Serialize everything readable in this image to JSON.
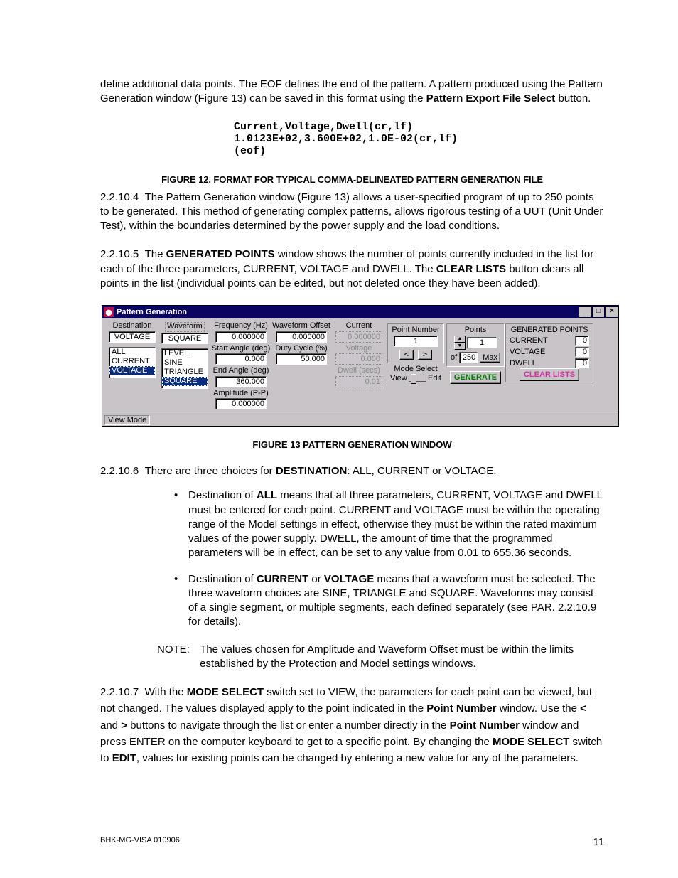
{
  "intro_para": "define additional data points. The EOF defines the end of the pattern. A pattern produced using the Pattern Generation window (Figure 13) can be saved in this format using the ",
  "intro_bold": "Pattern Export File Select",
  "intro_tail": " button.",
  "pre_line1": "Current,Voltage,Dwell(cr,lf)",
  "pre_line2": "1.0123E+02,3.600E+02,1.0E-02(cr,lf)",
  "pre_line3": "(eof)",
  "fig12": "FIGURE 12.    FORMAT FOR TYPICAL COMMA-DELINEATED PATTERN GENERATION FILE",
  "p_2_2_10_4_num": "2.2.10.4",
  "p_2_2_10_4": "The Pattern Generation window (Figure 13) allows a user-specified program of up to 250 points to be generated. This method of generating complex patterns, allows rigorous testing of a UUT (Unit Under Test), within the boundaries determined by the power supply and the load conditions.",
  "p_2_2_10_5_num": "2.2.10.5",
  "p_2_2_10_5_a": "The ",
  "p_2_2_10_5_b": "GENERATED POINTS",
  "p_2_2_10_5_c": " window shows the number of points currently included in the list for each of the three parameters, CURRENT, VOLTAGE and DWELL. The ",
  "p_2_2_10_5_d": "CLEAR LISTS",
  "p_2_2_10_5_e": " button clears all points in the list (individual points can be edited, but not deleted once they have been added).",
  "fig13": "FIGURE 13  PATTERN GENERATION WINDOW",
  "p_2_2_10_6_num": "2.2.10.6",
  "p_2_2_10_6_a": "There are three choices for ",
  "p_2_2_10_6_b": "DESTINATION",
  "p_2_2_10_6_c": ": ALL, CURRENT or VOLTAGE.",
  "bullet1_a": "Destination of ",
  "bullet1_b": "ALL",
  "bullet1_c": " means that all three parameters, CURRENT, VOLTAGE and DWELL must be entered for each point. CURRENT and VOLTAGE must be within the operating range of the Model settings in effect, otherwise they must be within the rated maximum values of the power supply. DWELL, the amount of time that the programmed parameters will be in effect, can be set to any value from 0.01 to 655.36 seconds.",
  "bullet2_a": "Destination of ",
  "bullet2_b": "CURRENT",
  "bullet2_c": " or ",
  "bullet2_d": "VOLTAGE",
  "bullet2_e": " means that a waveform must be selected. The three waveform choices are SINE, TRIANGLE and SQUARE. Waveforms may consist of a single segment, or multiple segments, each defined separately (see PAR. 2.2.10.9 for details).",
  "note_label": "NOTE:",
  "note_body": "The values chosen for Amplitude and Waveform Offset must be within the limits established by the Protection and Model settings windows.",
  "p_2_2_10_7_num": "2.2.10.7",
  "p_2_2_10_7_a": "With the ",
  "p_2_2_10_7_b": "MODE SELECT",
  "p_2_2_10_7_c": " switch set to VIEW, the parameters for each point can be viewed, but not changed. The values displayed apply to the point indicated in the ",
  "p_2_2_10_7_d": "Point Number",
  "p_2_2_10_7_e": " window. Use the ",
  "p_2_2_10_7_lt": "<",
  "p_2_2_10_7_f": " and ",
  "p_2_2_10_7_gt": ">",
  "p_2_2_10_7_g": " buttons to navigate through the list or enter a number directly in the ",
  "p_2_2_10_7_h": "Point Number",
  "p_2_2_10_7_i": " window and press ENTER on the computer keyboard to get to a specific point. By changing the ",
  "p_2_2_10_7_j": "MODE SELECT",
  "p_2_2_10_7_k": " switch to ",
  "p_2_2_10_7_l": "EDIT",
  "p_2_2_10_7_m": ", values for existing points can be changed by entering a new value for any of the parameters.",
  "footer_left": "BHK-MG-VISA 010906",
  "footer_page": "11",
  "win": {
    "title": "Pattern Generation",
    "min": "_",
    "max": "□",
    "close": "×",
    "destination": {
      "label": "Destination",
      "value": "VOLTAGE",
      "options": [
        "ALL",
        "CURRENT",
        "VOLTAGE"
      ]
    },
    "waveform": {
      "label": "Waveform",
      "value": "SQUARE",
      "options": [
        "LEVEL",
        "SINE",
        "TRIANGLE",
        "SQUARE"
      ]
    },
    "freq": {
      "label": "Frequency (Hz)",
      "value": "0.000000"
    },
    "start": {
      "label": "Start Angle (deg)",
      "value": "0.000"
    },
    "end": {
      "label": "End Angle (deg)",
      "value": "360.000"
    },
    "amp": {
      "label": "Amplitude (P-P)",
      "value": "0.000000"
    },
    "offset": {
      "label": "Waveform Offset",
      "value": "0.000000"
    },
    "duty": {
      "label": "Duty Cycle (%)",
      "value": "50.000"
    },
    "current": {
      "label": "Current",
      "value": "0.000000"
    },
    "voltage": {
      "label": "Voltage",
      "value": "0.000"
    },
    "dwell": {
      "label": "Dwell (secs)",
      "value": "0.01"
    },
    "pointnum": {
      "label": "Point Number",
      "value": "1",
      "prev": "<",
      "next": ">"
    },
    "modeselect": {
      "label": "Mode Select",
      "left": "View",
      "right": "Edit"
    },
    "points": {
      "label": "Points",
      "value": "1",
      "of": "of",
      "max": "250",
      "maxbtn": "Max"
    },
    "generate": "GENERATE",
    "genpoints": {
      "title": "GENERATED POINTS",
      "rows": [
        {
          "name": "CURRENT",
          "val": "0"
        },
        {
          "name": "VOLTAGE",
          "val": "0"
        },
        {
          "name": "DWELL",
          "val": "0"
        }
      ],
      "clear": "CLEAR LISTS"
    },
    "status": "View Mode"
  }
}
